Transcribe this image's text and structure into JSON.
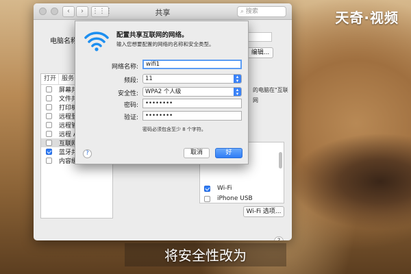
{
  "watermark": "天奇·视频",
  "window": {
    "title": "共享",
    "search_placeholder": "搜索",
    "computer_name_label": "电脑名称:",
    "edit_button": "编辑...",
    "services": {
      "col_on": "打开",
      "col_service": "服务",
      "items": [
        {
          "label": "屏幕共享",
          "checked": false,
          "selected": false
        },
        {
          "label": "文件共享",
          "checked": false,
          "selected": false
        },
        {
          "label": "打印机共享",
          "checked": false,
          "selected": false
        },
        {
          "label": "远程登录",
          "checked": false,
          "selected": false
        },
        {
          "label": "远程管理",
          "checked": false,
          "selected": false
        },
        {
          "label": "远程 Apple 事件",
          "checked": false,
          "selected": false
        },
        {
          "label": "互联网共享",
          "checked": false,
          "selected": true
        },
        {
          "label": "蓝牙共享",
          "checked": true,
          "selected": false
        },
        {
          "label": "内容缓存",
          "checked": false,
          "selected": false
        }
      ]
    },
    "description_fragment": "的电脑在\"互联",
    "description_fragment2": "网",
    "ports": [
      {
        "label": "Wi-Fi",
        "checked": true
      },
      {
        "label": "iPhone USB",
        "checked": false
      }
    ],
    "wifi_options_button": "Wi-Fi 选项..."
  },
  "sheet": {
    "title": "配置共享互联网的网络。",
    "subtitle": "输入您想要配置的网络的名称和安全类型。",
    "network_name_label": "网络名称:",
    "network_name_value": "wifi1",
    "channel_label": "频段:",
    "channel_value": "11",
    "security_label": "安全性:",
    "security_value": "WPA2 个人级",
    "password_label": "密码:",
    "password_value": "••••••••",
    "verify_label": "验证:",
    "verify_value": "••••••••",
    "hint": "密码必须包含至少 8 个字符。",
    "cancel_button": "取消",
    "ok_button": "好",
    "help": "?"
  },
  "help_main": "?",
  "subtitle": "将安全性改为"
}
